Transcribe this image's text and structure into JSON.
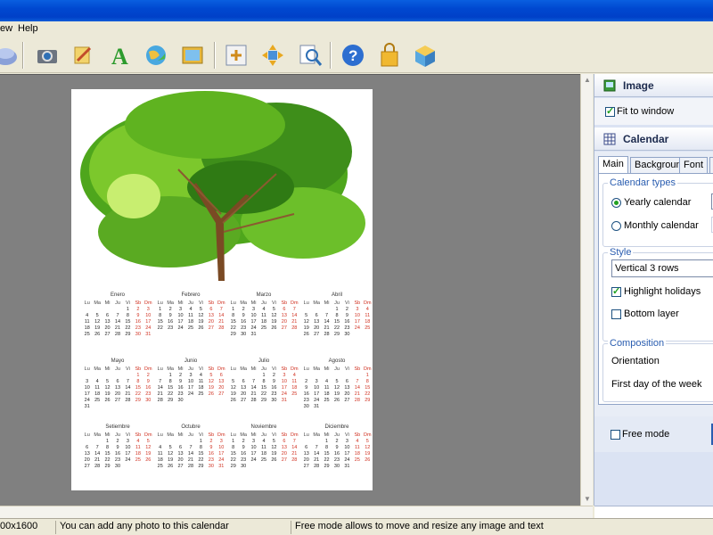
{
  "menu": {
    "view_label": "ew",
    "help_label": "Help"
  },
  "toolbar": {
    "icons": [
      "open-icon",
      "camera-icon",
      "edit-icon",
      "text-icon",
      "globe-icon",
      "image-icon",
      "fit-icon",
      "move-icon",
      "zoom-icon",
      "help-icon",
      "shop-icon",
      "box-icon"
    ]
  },
  "calendar": {
    "headers": [
      "Lu",
      "Ma",
      "Mi",
      "Ju",
      "Vi",
      "Sb",
      "Dm"
    ],
    "months": [
      {
        "name": "Enero",
        "offset": 4,
        "days": 31
      },
      {
        "name": "Febrero",
        "offset": 0,
        "days": 28
      },
      {
        "name": "Marzo",
        "offset": 0,
        "days": 31
      },
      {
        "name": "Abril",
        "offset": 3,
        "days": 30
      },
      {
        "name": "Mayo",
        "offset": 5,
        "days": 31
      },
      {
        "name": "Junio",
        "offset": 1,
        "days": 30
      },
      {
        "name": "Julio",
        "offset": 3,
        "days": 31
      },
      {
        "name": "Agosto",
        "offset": 6,
        "days": 31
      },
      {
        "name": "Setiembre",
        "offset": 2,
        "days": 30
      },
      {
        "name": "Octubre",
        "offset": 4,
        "days": 31
      },
      {
        "name": "Noviembre",
        "offset": 0,
        "days": 30
      },
      {
        "name": "Diciembre",
        "offset": 2,
        "days": 31
      }
    ]
  },
  "panel": {
    "image": {
      "title": "Image",
      "fit_label": "Fit to window",
      "fit_checked": true
    },
    "calendar": {
      "title": "Calendar",
      "tabs": [
        "Main",
        "Background",
        "Font"
      ],
      "types_title": "Calendar types",
      "yearly_label": "Yearly calendar",
      "monthly_label": "Monthly calendar",
      "style_title": "Style",
      "style_value": "Vertical 3 rows",
      "highlight_label": "Highlight holidays",
      "highlight_checked": true,
      "bottom_label": "Bottom layer",
      "bottom_checked": false,
      "composition_title": "Composition",
      "orientation_label": "Orientation",
      "first_day_label": "First day of the week"
    },
    "free_mode_label": "Free mode"
  },
  "status": {
    "size": "00x1600",
    "hint": "You can add any photo to this calendar",
    "free_hint": "Free mode allows to move and resize any image and text"
  },
  "colors": {
    "weekend": "#d03020",
    "panel_bg": "#dbe3f3",
    "canvas_bg": "#808080",
    "accent": "#2a5db0"
  }
}
